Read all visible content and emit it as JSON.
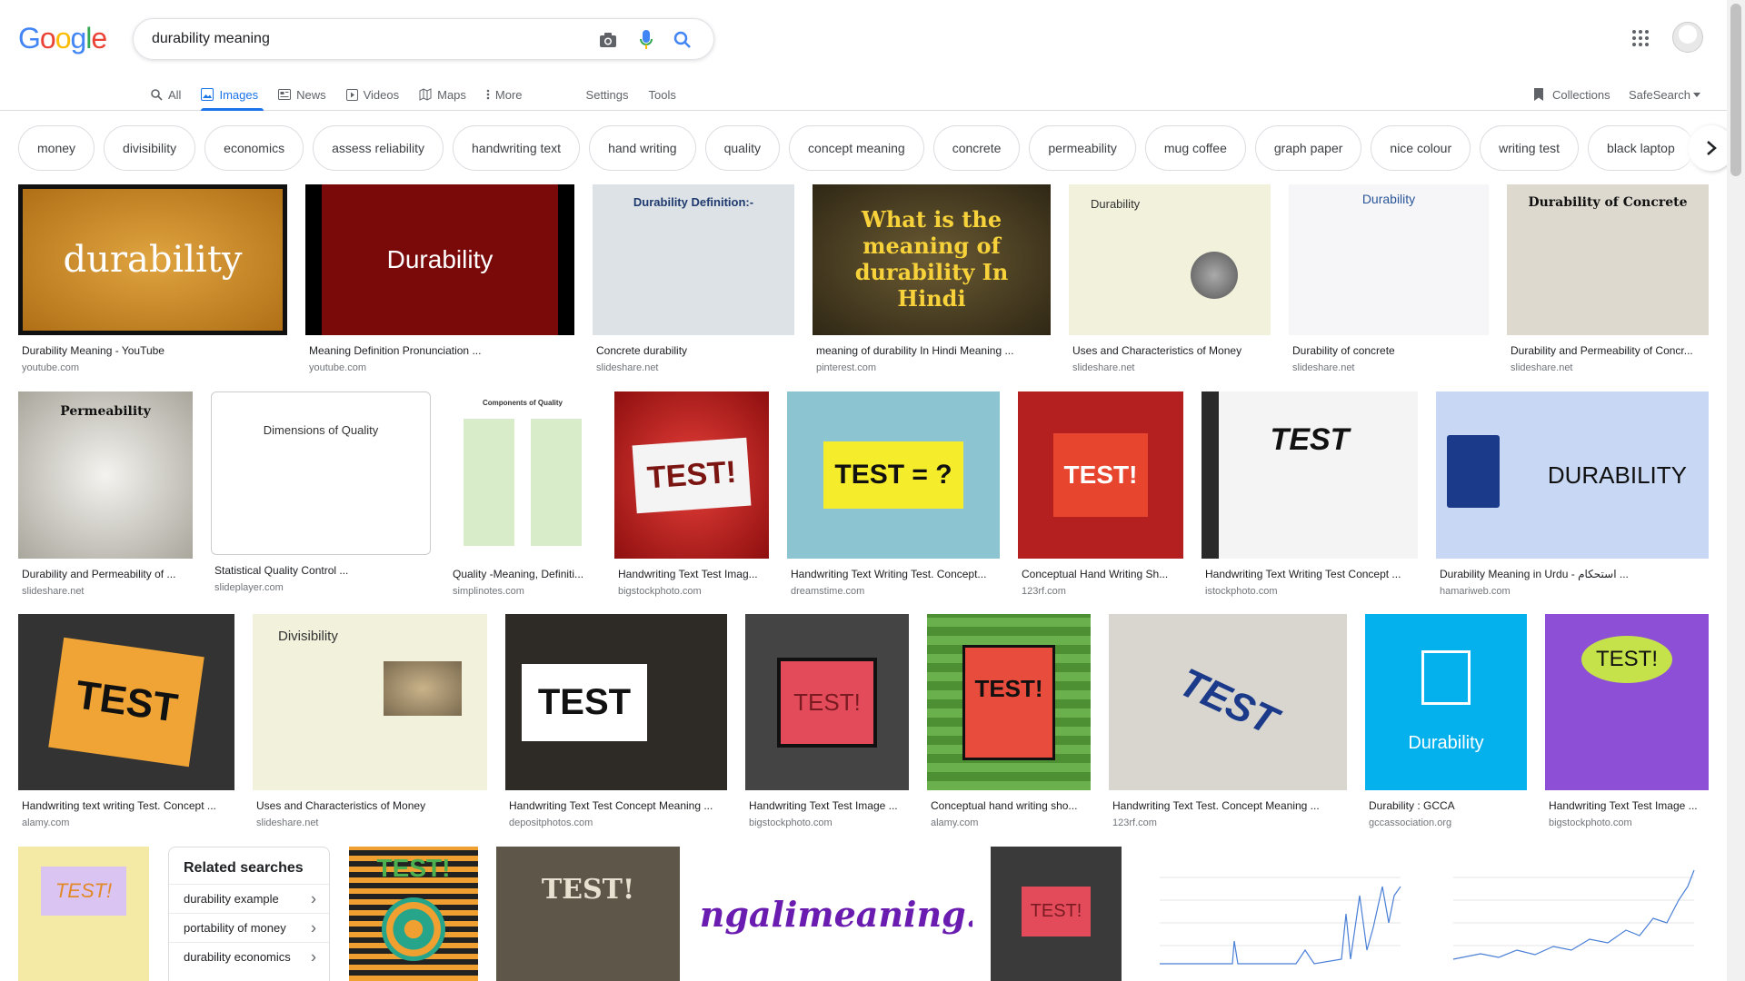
{
  "logo": "Google",
  "search": {
    "query": "durability meaning"
  },
  "tabs": [
    {
      "label": "All",
      "icon": "search-icon"
    },
    {
      "label": "Images",
      "icon": "image-icon",
      "active": true
    },
    {
      "label": "News",
      "icon": "news-icon"
    },
    {
      "label": "Videos",
      "icon": "video-icon"
    },
    {
      "label": "Maps",
      "icon": "map-icon"
    },
    {
      "label": "More",
      "icon": "more-vertical-icon"
    },
    {
      "label": "Settings"
    },
    {
      "label": "Tools"
    }
  ],
  "header_right": {
    "collections": "Collections",
    "safesearch": "SafeSearch"
  },
  "chips": [
    "money",
    "divisibility",
    "economics",
    "assess reliability",
    "handwriting text",
    "hand writing",
    "quality",
    "concept meaning",
    "concrete",
    "permeability",
    "mug coffee",
    "graph paper",
    "nice colour",
    "writing test",
    "black laptop"
  ],
  "results": [
    {
      "caption": "Durability Meaning - YouTube",
      "source": "youtube.com",
      "text": "durability"
    },
    {
      "caption": "Meaning Definition Pronunciation ...",
      "source": "youtube.com",
      "text": "Durability"
    },
    {
      "caption": "Concrete durability",
      "source": "slideshare.net",
      "text": "Durability Definition:-"
    },
    {
      "caption": "meaning of durability In Hindi Meaning ...",
      "source": "pinterest.com",
      "text": "What is the meaning of durability In Hindi"
    },
    {
      "caption": "Uses and Characteristics of Money",
      "source": "slideshare.net",
      "text": "Durability"
    },
    {
      "caption": "Durability of concrete",
      "source": "slideshare.net",
      "text": "Durability"
    },
    {
      "caption": "Durability and Permeability of Concr...",
      "source": "slideshare.net",
      "text": "Durability of Concrete"
    },
    {
      "caption": "Durability and Permeability of ...",
      "source": "slideshare.net",
      "text": "Permeability"
    },
    {
      "caption": "Statistical Quality Control ...",
      "source": "slideplayer.com",
      "text": "Dimensions of Quality"
    },
    {
      "caption": "Quality -Meaning, Definiti...",
      "source": "simplinotes.com",
      "text": "Components of Quality"
    },
    {
      "caption": "Handwriting Text Test Imag...",
      "source": "bigstockphoto.com",
      "text": "TEST!"
    },
    {
      "caption": "Handwriting Text Writing Test. Concept...",
      "source": "dreamstime.com",
      "text": "TEST = ?"
    },
    {
      "caption": "Conceptual Hand Writing Sh...",
      "source": "123rf.com",
      "text": "TEST!"
    },
    {
      "caption": "Handwriting Text Writing Test Concept ...",
      "source": "istockphoto.com",
      "text": "TEST"
    },
    {
      "caption": "Durability Meaning in Urdu - استحکام ...",
      "source": "hamariweb.com",
      "text": "DURABILITY"
    },
    {
      "caption": "Handwriting text writing Test. Concept ...",
      "source": "alamy.com",
      "text": "TEST"
    },
    {
      "caption": "Uses and Characteristics of Money",
      "source": "slideshare.net",
      "text": "Divisibility"
    },
    {
      "caption": "Handwriting Text Test Concept Meaning ...",
      "source": "depositphotos.com",
      "text": "TEST"
    },
    {
      "caption": "Handwriting Text Test Image ...",
      "source": "bigstockphoto.com",
      "text": "TEST!"
    },
    {
      "caption": "Conceptual hand writing sho...",
      "source": "alamy.com",
      "text": "TEST!"
    },
    {
      "caption": "Handwriting Text Test. Concept Meaning ...",
      "source": "123rf.com",
      "text": "TEST"
    },
    {
      "caption": "Durability : GCCA",
      "source": "gccassociation.org",
      "text": "Durability"
    },
    {
      "caption": "Handwriting Text Test Image ...",
      "source": "bigstockphoto.com",
      "text": "TEST!"
    },
    {
      "text": "TEST!"
    },
    {
      "text": "TEST!"
    },
    {
      "text": "TEST!"
    },
    {
      "text": "Bengalimeaning.com"
    },
    {
      "text": "TEST!"
    },
    {
      "text": ""
    },
    {
      "text": ""
    }
  ],
  "related": {
    "heading": "Related searches",
    "items": [
      "durability example",
      "portability of money",
      "durability economics"
    ]
  }
}
